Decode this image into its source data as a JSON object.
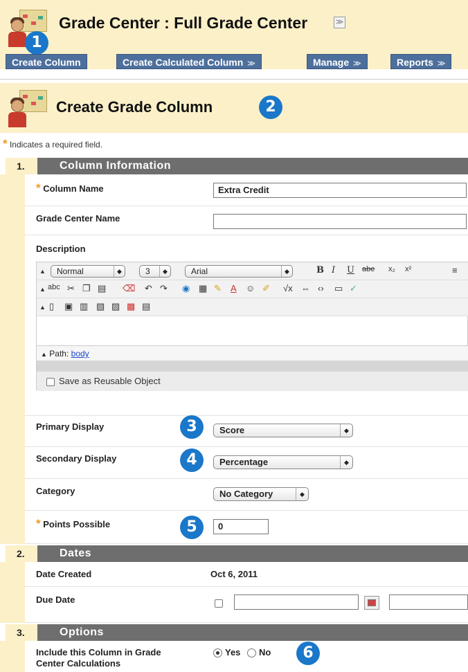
{
  "header": {
    "title": "Grade Center : Full Grade Center",
    "menu_chevron": "≫",
    "toolbar": [
      {
        "label": "Create Column",
        "chevron": ""
      },
      {
        "label": "Create Calculated Column",
        "chevron": "≫"
      },
      {
        "label": "Manage",
        "chevron": "≫"
      },
      {
        "label": "Reports",
        "chevron": "≫"
      }
    ]
  },
  "page": {
    "title": "Create Grade Column",
    "required_note": "Indicates a required field."
  },
  "callouts": [
    "1",
    "2",
    "3",
    "4",
    "5",
    "6"
  ],
  "sections": [
    {
      "num": "1.",
      "title": "Column Information"
    },
    {
      "num": "2.",
      "title": "Dates"
    },
    {
      "num": "3.",
      "title": "Options"
    }
  ],
  "column_info": {
    "column_name_label": "Column Name",
    "column_name_value": "Extra Credit",
    "grade_center_name_label": "Grade Center Name",
    "grade_center_name_value": "",
    "description_label": "Description",
    "editor": {
      "format": "Normal",
      "size": "3",
      "font": "Arial",
      "path_label": "Path:",
      "path_value": "body",
      "reusable_label": "Save as Reusable Object"
    },
    "primary_display_label": "Primary Display",
    "primary_display_value": "Score",
    "secondary_display_label": "Secondary Display",
    "secondary_display_value": "Percentage",
    "category_label": "Category",
    "category_value": "No Category",
    "points_label": "Points Possible",
    "points_value": "0"
  },
  "dates": {
    "created_label": "Date Created",
    "created_value": "Oct 6, 2011",
    "due_label": "Due Date"
  },
  "options": {
    "include_label_line1": "Include this Column in Grade",
    "include_label_line2": "Center Calculations",
    "yes_label": "Yes",
    "no_label": "No",
    "selected": "Yes"
  },
  "colors": {
    "banner": "#fbf0c8",
    "toolbar_button": "#4d6f9c",
    "section_bar": "#6e6e6e",
    "callout": "#1a77c9",
    "required_star": "#f19a1c"
  }
}
